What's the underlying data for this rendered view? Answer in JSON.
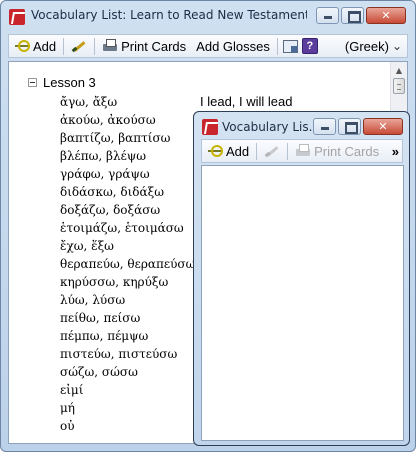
{
  "main_window": {
    "title": "Vocabulary List: Learn to Read New Testament Gre...",
    "toolbar": {
      "add_label": "Add",
      "print_cards_label": "Print Cards",
      "add_glosses_label": "Add Glosses",
      "language_label": "(Greek)",
      "help_glyph": "?"
    },
    "lesson_label": "Lesson 3",
    "words": [
      "ἄγω, ἄξω",
      "ἀκούω, ἀκούσω",
      "βαπτίζω, βαπτίσω",
      "βλέπω, βλέψω",
      "γράφω, γράψω",
      "διδάσκω, διδάξω",
      "δοξάζω, δοξάσω",
      "ἑτοιμάζω, ἑτοιμάσω",
      "ἔχω, ἕξω",
      "θεραπεύω, θεραπεύσω",
      "κηρύσσω, κηρύξω",
      "λύω, λύσω",
      "πείθω, πείσω",
      "πέμπω, πέμψω",
      "πιστεύω, πιστεύσω",
      "σώζω, σώσω",
      "εἰμί",
      "μή",
      "οὐ"
    ],
    "first_gloss": "I lead, I will lead"
  },
  "sub_window": {
    "title": "Vocabulary Lis...",
    "toolbar": {
      "add_label": "Add",
      "print_cards_label": "Print Cards",
      "overflow_glyph": "»"
    }
  },
  "icons": [
    "app-icon",
    "add-icon",
    "edit-pen-icon",
    "print-icon",
    "window-icon",
    "help-icon",
    "chevron-down-icon",
    "overflow-chevron-icon",
    "minimize-icon",
    "maximize-icon",
    "close-icon"
  ],
  "colors": {
    "title_text": "#1b2d44",
    "close_button": "#c84b36",
    "app_icon": "#c8262c",
    "disabled_text": "#a3a3a3"
  }
}
